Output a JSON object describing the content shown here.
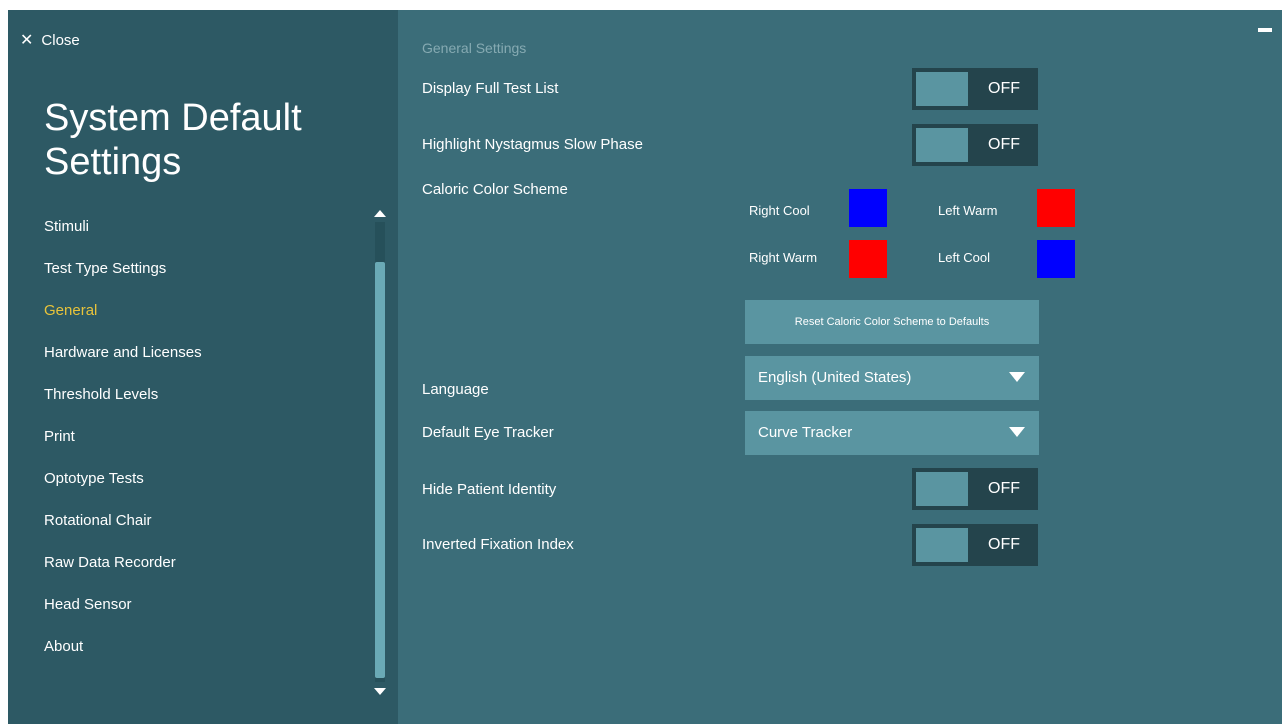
{
  "close": {
    "label": "Close",
    "icon": "close-icon"
  },
  "sidebar": {
    "title": "System Default Settings",
    "items": [
      {
        "label": "Stimuli"
      },
      {
        "label": "Test Type Settings"
      },
      {
        "label": "General",
        "active": true
      },
      {
        "label": "Hardware and Licenses"
      },
      {
        "label": "Threshold Levels"
      },
      {
        "label": "Print"
      },
      {
        "label": "Optotype Tests"
      },
      {
        "label": "Rotational Chair"
      },
      {
        "label": "Raw Data Recorder"
      },
      {
        "label": "Head Sensor"
      },
      {
        "label": "About"
      }
    ]
  },
  "main": {
    "section_title": "General Settings",
    "display_full_test_list": {
      "label": "Display Full Test List",
      "state": "OFF"
    },
    "highlight_nystagmus": {
      "label": "Highlight Nystagmus Slow Phase",
      "state": "OFF"
    },
    "caloric": {
      "label": "Caloric Color Scheme",
      "right_cool": {
        "label": "Right Cool",
        "color": "#0000ff"
      },
      "left_warm": {
        "label": "Left Warm",
        "color": "#ff0000"
      },
      "right_warm": {
        "label": "Right Warm",
        "color": "#ff0000"
      },
      "left_cool": {
        "label": "Left Cool",
        "color": "#0000ff"
      },
      "reset_label": "Reset Caloric Color Scheme to Defaults"
    },
    "language": {
      "label": "Language",
      "value": "English (United States)"
    },
    "eye_tracker": {
      "label": "Default Eye Tracker",
      "value": "Curve Tracker"
    },
    "hide_patient_identity": {
      "label": "Hide Patient Identity",
      "state": "OFF"
    },
    "inverted_fixation_index": {
      "label": "Inverted Fixation Index",
      "state": "OFF"
    }
  },
  "colors": {
    "background": "#3b6d79",
    "sidebar": "#2d5964",
    "active_nav": "#e8c33a",
    "control": "#5a95a1",
    "toggle_track": "#24444c"
  }
}
